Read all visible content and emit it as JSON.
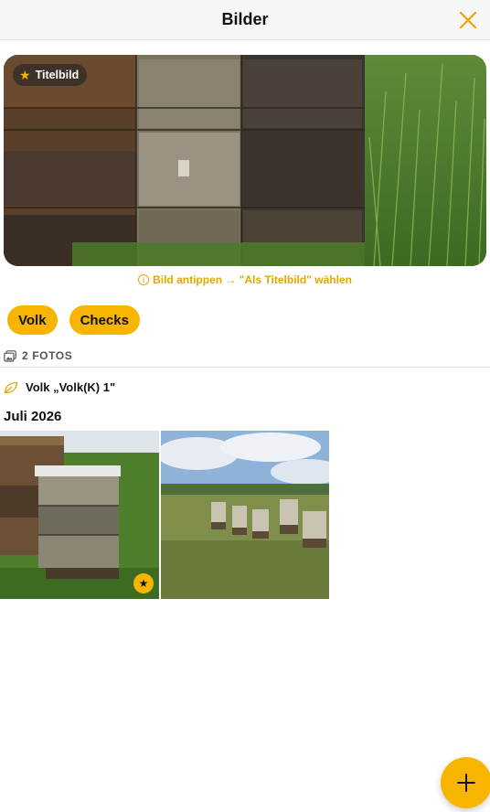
{
  "header": {
    "title": "Bilder",
    "close_icon": "close-icon",
    "accent": "#f7b500"
  },
  "cover": {
    "badge_label": "Titelbild",
    "badge_icon": "star-icon"
  },
  "hint": {
    "icon": "info-icon",
    "text": "Bild antippen → \"Als Titelbild\" wählen"
  },
  "filters": [
    {
      "label": "Volk"
    },
    {
      "label": "Checks"
    }
  ],
  "photos": {
    "icon": "photos-icon",
    "count_label": "2 FOTOS"
  },
  "group": {
    "icon": "leaf-icon",
    "label": "Volk „Volk(K) 1\""
  },
  "section": {
    "month": "Juli 2026"
  },
  "thumbnails": [
    {
      "kind": "beehives-close",
      "is_title_image": true
    },
    {
      "kind": "apiary-landscape",
      "is_title_image": false
    }
  ],
  "fab": {
    "icon": "plus-icon"
  }
}
